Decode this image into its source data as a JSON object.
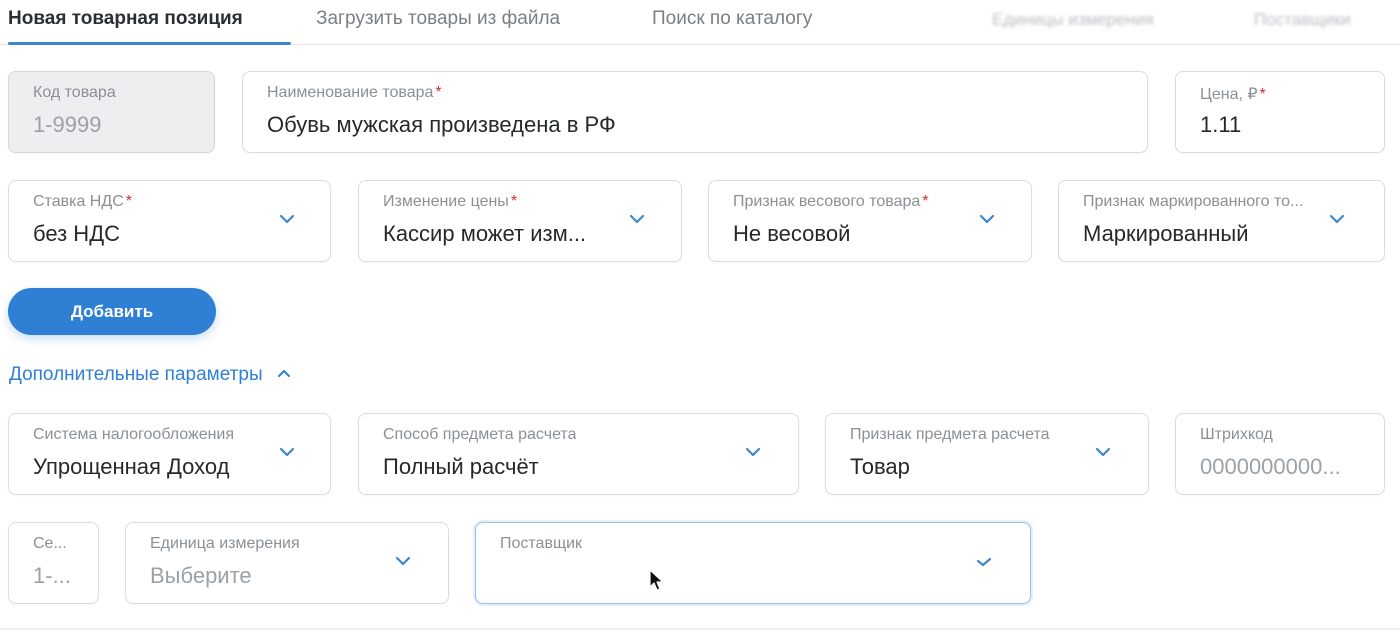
{
  "tabs": [
    {
      "label": "Новая товарная позиция"
    },
    {
      "label": "Загрузить товары из файла"
    },
    {
      "label": "Поиск по каталогу"
    },
    {
      "label": "Единицы измерения"
    },
    {
      "label": "Поставщики"
    }
  ],
  "row1": {
    "code": {
      "label": "Код товара",
      "value": "1-9999"
    },
    "name": {
      "label": "Наименование товара",
      "value": "Обувь мужская произведена в РФ"
    },
    "price": {
      "label": "Цена, ₽",
      "value": "1.11"
    }
  },
  "row2": {
    "vat": {
      "label": "Ставка НДС",
      "value": "без НДС"
    },
    "price_change": {
      "label": "Изменение цены",
      "value": "Кассир может изм..."
    },
    "weight": {
      "label": "Признак весового товара",
      "value": "Не весовой"
    },
    "marked": {
      "label": "Признак маркированного то...",
      "value": "Маркированный"
    }
  },
  "add_button": {
    "label": "Добавить"
  },
  "more_params": {
    "label": "Дополнительные параметры"
  },
  "row3": {
    "tax_system": {
      "label": "Система налогообложения",
      "value": "Упрощенная Доход"
    },
    "payment_method": {
      "label": "Способ предмета расчета",
      "value": "Полный расчёт"
    },
    "payment_subject": {
      "label": "Признак предмета расчета",
      "value": "Товар"
    },
    "barcode": {
      "label": "Штрихкод",
      "placeholder": "0000000000..."
    }
  },
  "row4": {
    "section": {
      "label": "Се...",
      "value": "1-..."
    },
    "unit": {
      "label": "Единица измерения",
      "placeholder": "Выберите"
    },
    "supplier": {
      "label": "Поставщик",
      "value": ""
    }
  },
  "colors": {
    "accent": "#2f7fd4",
    "required": "#d32f2f"
  }
}
